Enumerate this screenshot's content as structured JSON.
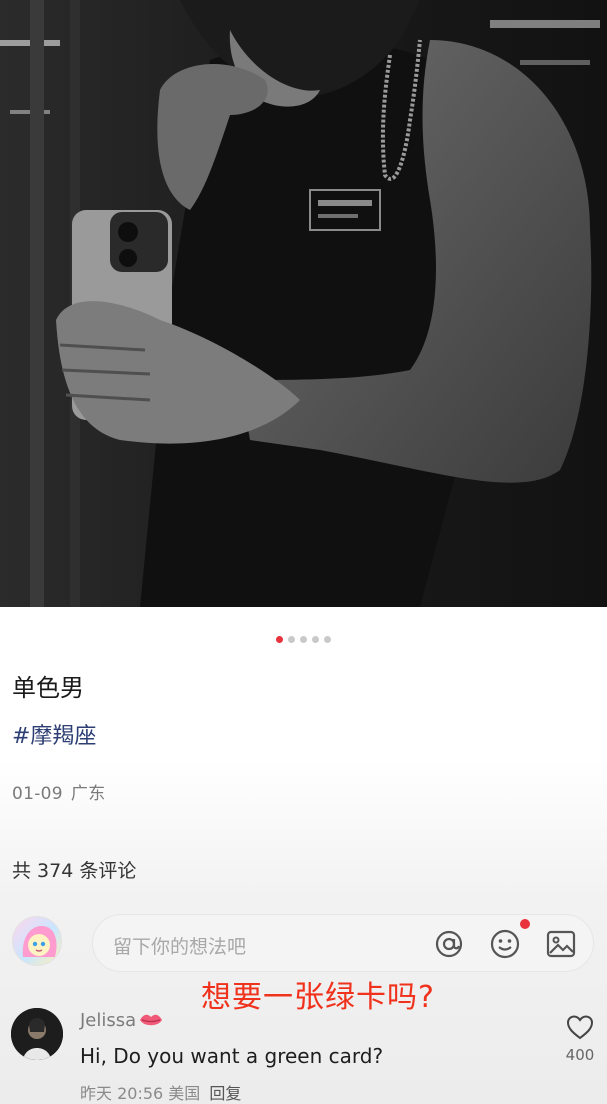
{
  "carousel": {
    "total": 5,
    "active_index": 0
  },
  "post": {
    "title": "单色男",
    "hashtag": "#摩羯座",
    "date": "01-09",
    "location": "广东"
  },
  "comments_section": {
    "count_label": "共 374 条评论"
  },
  "comment_input": {
    "placeholder": "留下你的想法吧",
    "icons": [
      "at-icon",
      "emoji-icon",
      "image-icon"
    ],
    "notification_dot_color": "#e8323c"
  },
  "overlay_caption": "想要一张绿卡吗?",
  "comment": {
    "username": "Jelissa",
    "username_badge": "lips-icon",
    "text": "Hi, Do you want a green card?",
    "time": "昨天 20:56",
    "region": "美国",
    "reply_label": "回复",
    "like_count": "400"
  },
  "colors": {
    "accent": "#e8323c",
    "caption": "#f0321c",
    "hashtag": "#2c3e73"
  }
}
